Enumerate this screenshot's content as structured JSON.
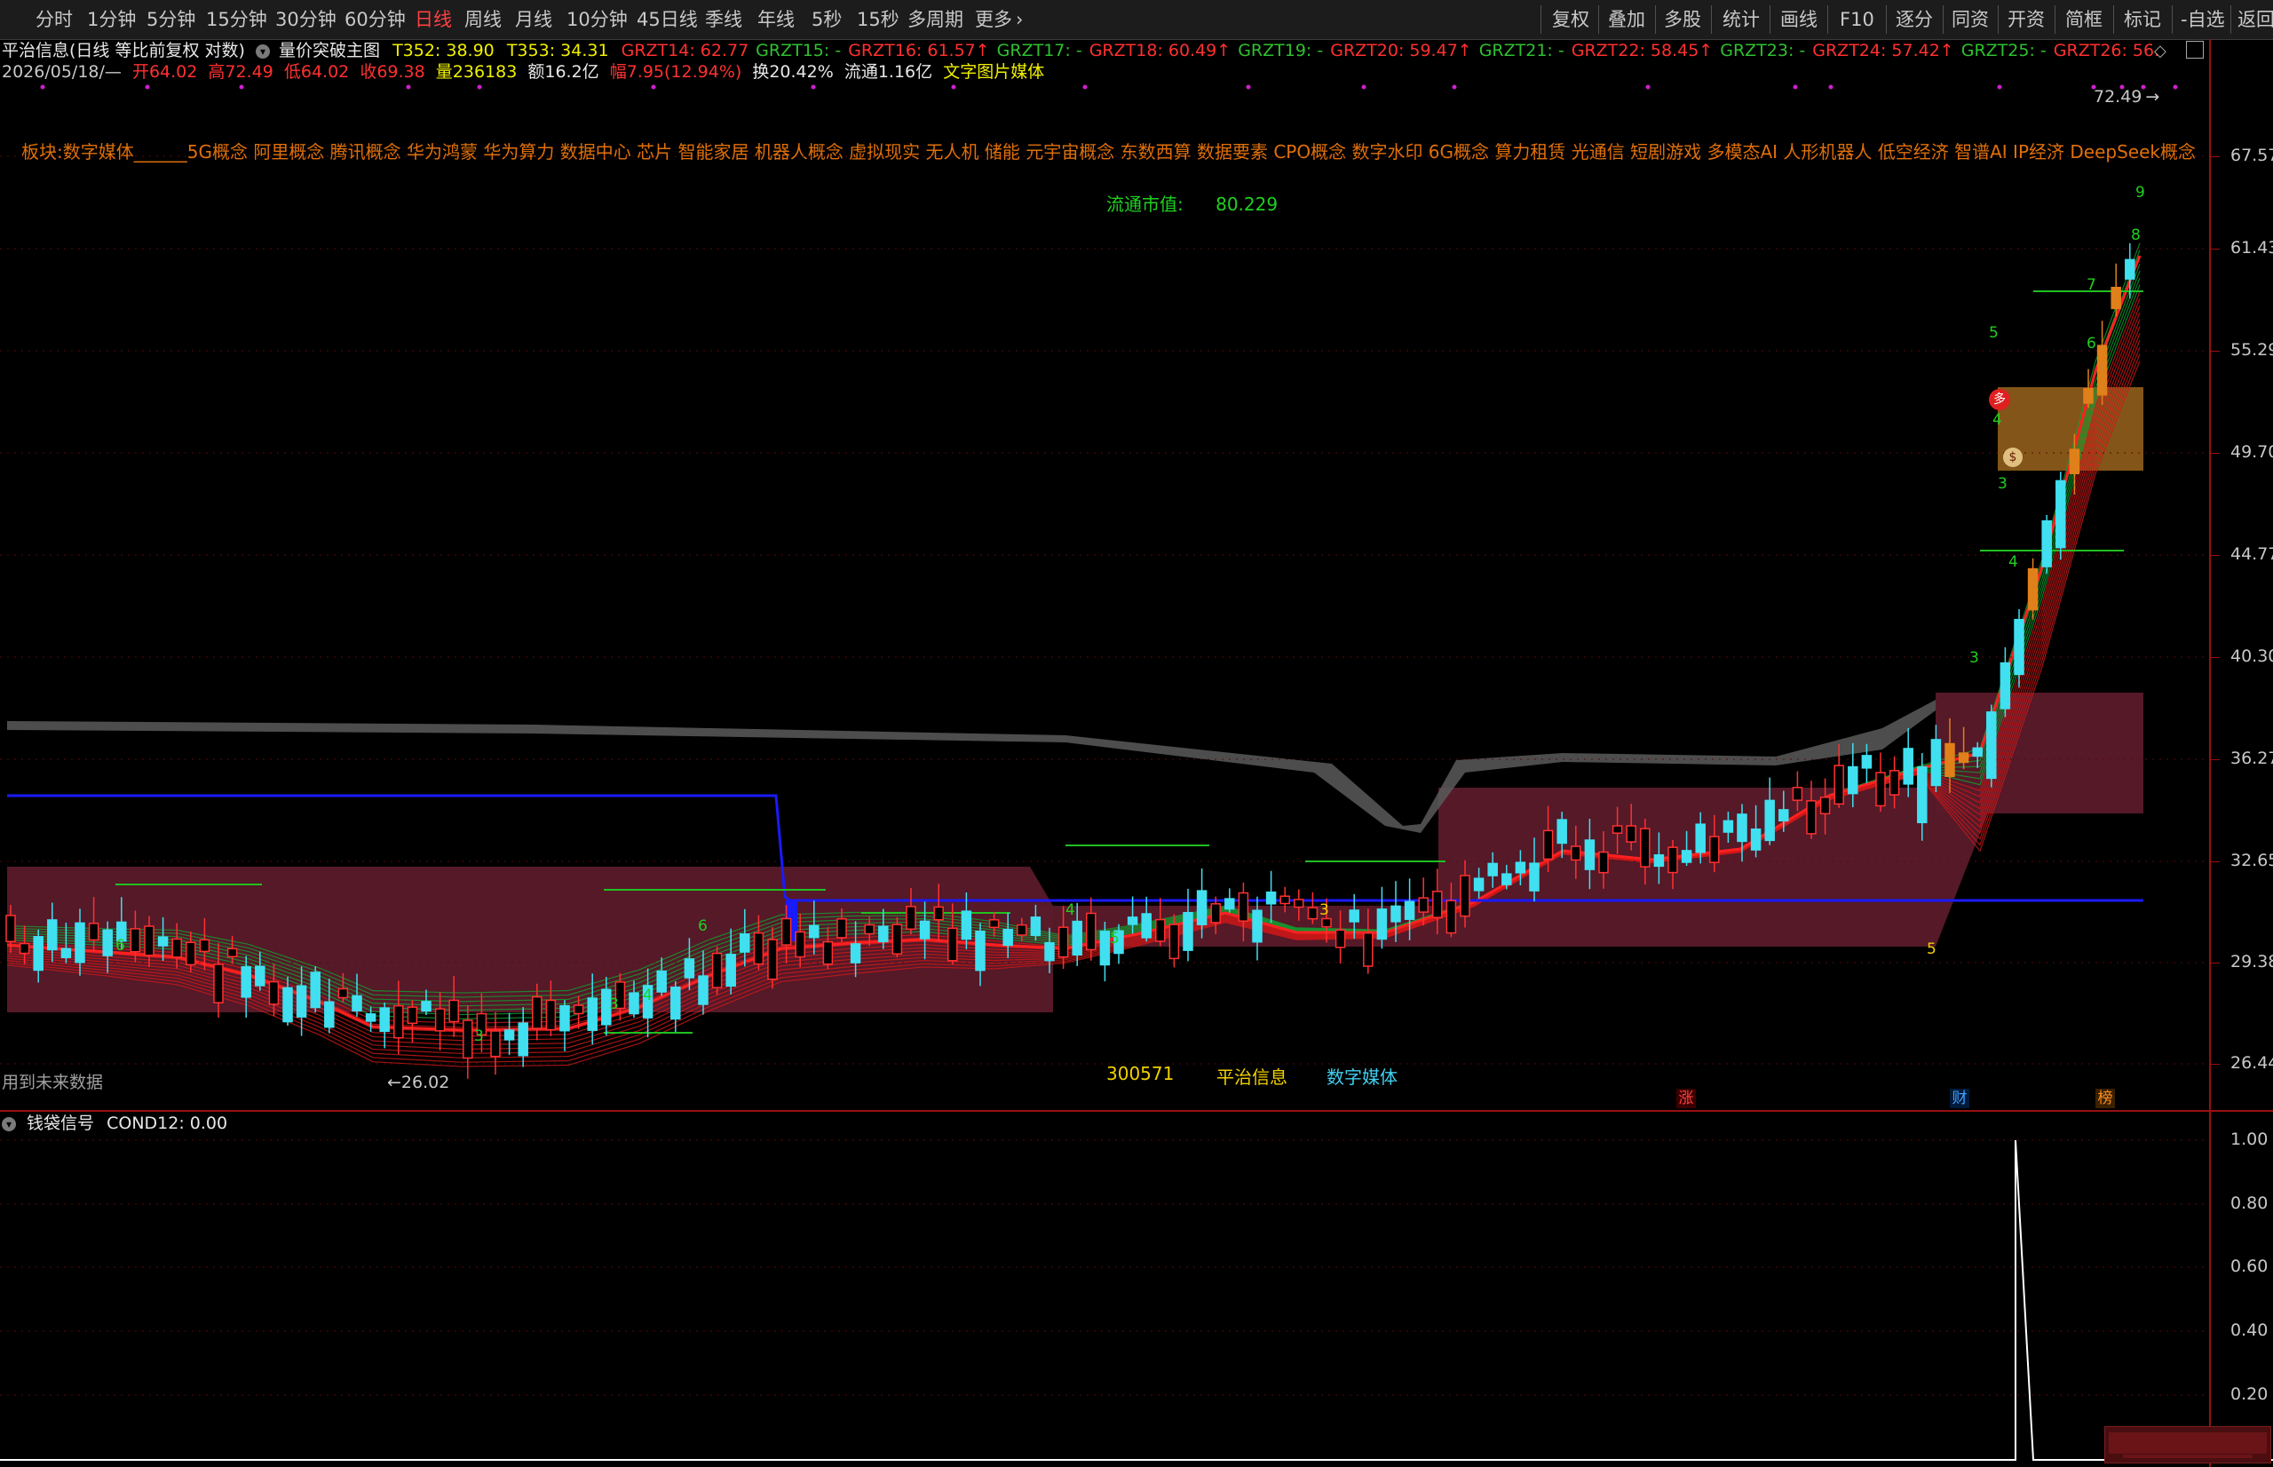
{
  "toolbar": {
    "periods": [
      "分时",
      "1分钟",
      "5分钟",
      "15分钟",
      "30分钟",
      "60分钟",
      "日线",
      "周线",
      "月线",
      "10分钟",
      "45日线",
      "季线",
      "年线",
      "5秒",
      "15秒",
      "多周期",
      "更多"
    ],
    "active_period": "日线",
    "tools": [
      "复权",
      "叠加",
      "多股",
      "统计",
      "画线",
      "F10",
      "逐分",
      "同资",
      "开资",
      "简框",
      "标记",
      "-自选",
      "返回"
    ]
  },
  "header": {
    "stock_title": "平治信息(日线 等比前复权 对数)",
    "indicator_name": "量价突破主图",
    "t352": "T352: 38.90",
    "t353": "T353: 34.31",
    "grzt_items": [
      {
        "text": "GRZT14: 62.77",
        "color": "#ff3030"
      },
      {
        "text": "GRZT15: -",
        "color": "#30c030"
      },
      {
        "text": "GRZT16: 61.57↑",
        "color": "#ff3030"
      },
      {
        "text": "GRZT17: -",
        "color": "#30c030"
      },
      {
        "text": "GRZT18: 60.49↑",
        "color": "#ff3030"
      },
      {
        "text": "GRZT19: -",
        "color": "#30c030"
      },
      {
        "text": "GRZT20: 59.47↑",
        "color": "#ff3030"
      },
      {
        "text": "GRZT21: -",
        "color": "#30c030"
      },
      {
        "text": "GRZT22: 58.45↑",
        "color": "#ff3030"
      },
      {
        "text": "GRZT23: -",
        "color": "#30c030"
      },
      {
        "text": "GRZT24: 57.42↑",
        "color": "#ff3030"
      },
      {
        "text": "GRZT25: -",
        "color": "#30c030"
      },
      {
        "text": "GRZT26: 56.",
        "color": "#ff3030"
      }
    ],
    "date": "2026/05/18/—",
    "open": "开64.02",
    "high": "高72.49",
    "low": "低64.02",
    "close": "收69.38",
    "volume": "量236183",
    "amount": "额16.2亿",
    "change": "幅7.95(12.94%)",
    "turnover": "换20.42%",
    "float_shares": "流通1.16亿",
    "sector_tag": "文字图片媒体"
  },
  "sector_line": "板块:数字媒体______5G概念 阿里概念 腾讯概念 华为鸿蒙 华为算力 数据中心 芯片 智能家居 机器人概念 虚拟现实 无人机 储能 元宇宙概念 东数西算 数据要素 CPO概念 数字水印 6G概念 算力租赁 光通信 短剧游戏 多模态AI 人形机器人 低空经济 智谱AI IP经济 DeepSeek概念",
  "float_cap": {
    "label": "流通市值:",
    "value": "80.229"
  },
  "stock_info": {
    "code": "300571",
    "name": "平治信息",
    "sector": "数字媒体"
  },
  "footer_note": "用到未来数据",
  "main_axis": [
    "67.57",
    "61.43",
    "55.29",
    "49.70",
    "44.77",
    "40.30",
    "36.27",
    "32.65",
    "29.38",
    "26.44"
  ],
  "price_marks": {
    "high": "72.49",
    "low": "26.02"
  },
  "badges": {
    "zhang": "涨",
    "cai": "财",
    "bang": "榜"
  },
  "count_labels": [
    "3",
    "4",
    "5",
    "6",
    "7",
    "8",
    "9",
    "3",
    "4",
    "5",
    "6",
    "3",
    "4",
    "5",
    "6",
    "3",
    "4",
    "3"
  ],
  "sub_panel": {
    "title": "钱袋信号",
    "value": "COND12: 0.00",
    "axis": [
      "1.00",
      "0.80",
      "0.60",
      "0.40",
      "0.20"
    ]
  },
  "colors": {
    "up": "#ff3030",
    "down": "#40e0f0",
    "green": "#20c020",
    "box": "#5a1a2a",
    "blue_line": "#1a1aff",
    "active": "#ff4040"
  }
}
